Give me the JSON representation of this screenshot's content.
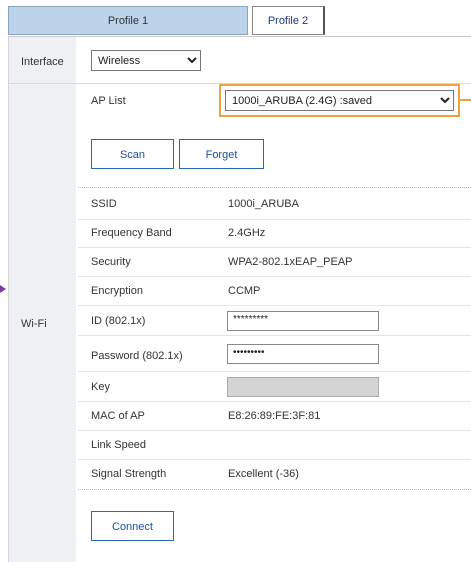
{
  "tabs": [
    {
      "label": "Profile 1",
      "active": true
    },
    {
      "label": "Profile 2",
      "active": false
    }
  ],
  "interface": {
    "label": "Interface",
    "selected": "Wireless"
  },
  "wifi_section": {
    "label": "Wi-Fi"
  },
  "ap_list": {
    "label": "AP List",
    "selected": "1000i_ARUBA (2.4G) :saved"
  },
  "buttons": {
    "scan": "Scan",
    "forget": "Forget",
    "connect": "Connect"
  },
  "fields": {
    "ssid": {
      "label": "SSID",
      "value": "1000i_ARUBA"
    },
    "frequency_band": {
      "label": "Frequency Band",
      "value": "2.4GHz"
    },
    "security": {
      "label": "Security",
      "value": "WPA2-802.1xEAP_PEAP"
    },
    "encryption": {
      "label": "Encryption",
      "value": "CCMP"
    },
    "id": {
      "label": "ID (802.1x)",
      "value": "*********"
    },
    "password": {
      "label": "Password (802.1x)",
      "value": "•••••••••"
    },
    "key": {
      "label": "Key",
      "value": ""
    },
    "mac": {
      "label": "MAC of AP",
      "value": "E8:26:89:FE:3F:81"
    },
    "link_speed": {
      "label": "Link Speed",
      "value": ""
    },
    "signal_strength": {
      "label": "Signal Strength",
      "value": "Excellent (-36)"
    }
  },
  "colors": {
    "active_tab": "#bcd3ea",
    "left_column": "#eef0f4",
    "button_border": "#2a66b8",
    "highlight": "#f0a040",
    "arrow": "#7a3ca0"
  }
}
